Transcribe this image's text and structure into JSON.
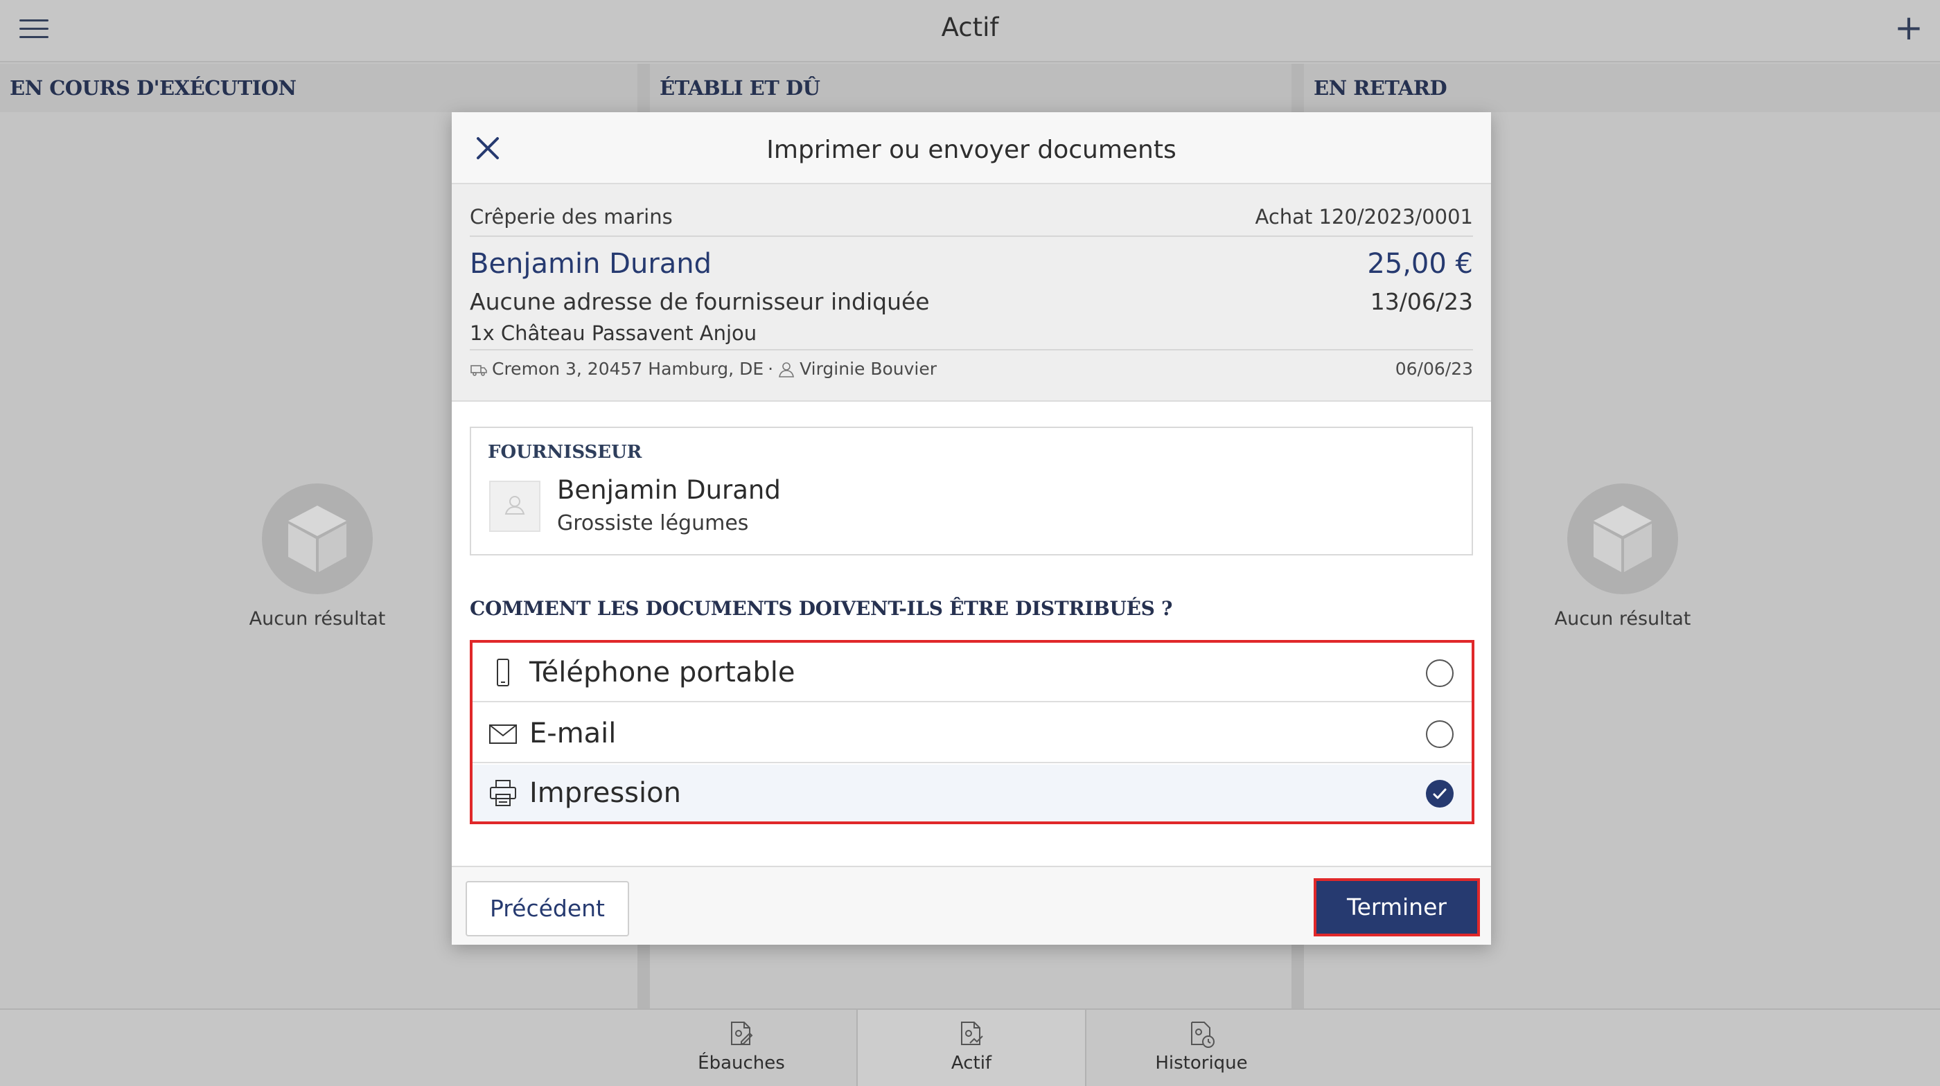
{
  "app": {
    "title": "Actif",
    "menu_icon": "hamburger-menu-icon",
    "add_icon": "plus-icon"
  },
  "columns": [
    {
      "header": "EN COURS D'EXÉCUTION",
      "empty_label": "Aucun résultat"
    },
    {
      "header": "ÉTABLI ET DÛ"
    },
    {
      "header": "EN RETARD",
      "empty_label": "Aucun résultat"
    }
  ],
  "bottom_nav": [
    {
      "label": "Ébauches",
      "icon": "drafts-icon"
    },
    {
      "label": "Actif",
      "icon": "active-icon",
      "active": true
    },
    {
      "label": "Historique",
      "icon": "history-icon"
    }
  ],
  "modal": {
    "title": "Imprimer ou envoyer documents",
    "summary": {
      "restaurant": "Crêperie des marins",
      "reference": "Achat 120/2023/0001",
      "supplier_name": "Benjamin Durand",
      "amount": "25,00 €",
      "address_note": "Aucune adresse de fournisseur indiquée",
      "date": "13/06/23",
      "item": "1x Château Passavent Anjou",
      "location": "Cremon 3, 20457 Hamburg, DE",
      "separator": "·",
      "user": "Virginie Bouvier",
      "created_date": "06/06/23"
    },
    "supplier_section": {
      "header": "FOURNISSEUR",
      "name": "Benjamin Durand",
      "type": "Grossiste légumes"
    },
    "question": "COMMENT LES DOCUMENTS DOIVENT-ILS ÊTRE DISTRIBUÉS ?",
    "options": [
      {
        "label": "Téléphone portable",
        "icon": "mobile-phone-icon",
        "selected": false
      },
      {
        "label": "E-mail",
        "icon": "envelope-icon",
        "selected": false
      },
      {
        "label": "Impression",
        "icon": "printer-icon",
        "selected": true
      }
    ],
    "buttons": {
      "previous": "Précédent",
      "finish": "Terminer"
    }
  },
  "colors": {
    "accent": "#263a70",
    "highlight": "#e0282a",
    "background": "#c4c4c4"
  }
}
